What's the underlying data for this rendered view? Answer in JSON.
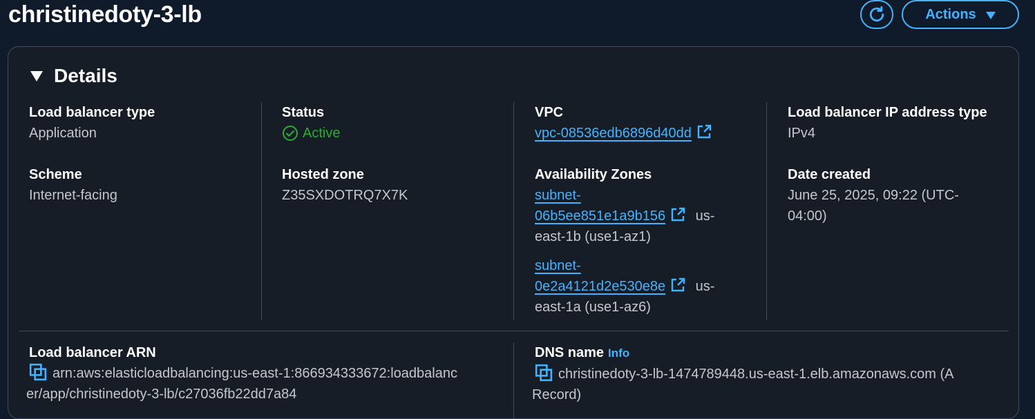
{
  "header": {
    "title": "christinedoty-3-lb",
    "actions_label": "Actions"
  },
  "details": {
    "title": "Details",
    "lb_type": {
      "label": "Load balancer type",
      "value": "Application"
    },
    "scheme": {
      "label": "Scheme",
      "value": "Internet-facing"
    },
    "status": {
      "label": "Status",
      "value": "Active"
    },
    "hosted_zone": {
      "label": "Hosted zone",
      "value": "Z35SXDOTRQ7X7K"
    },
    "vpc": {
      "label": "VPC",
      "value": "vpc-08536edb6896d40dd"
    },
    "availability_zones": {
      "label": "Availability Zones",
      "items": [
        {
          "subnet_line1": "subnet-",
          "subnet_line2": "06b5ee851e1a9b156",
          "zone_suffix": "us-",
          "zone_line2": "east-1b (use1-az1)"
        },
        {
          "subnet_line1": "subnet-",
          "subnet_line2": "0e2a4121d2e530e8e",
          "zone_suffix": "us-",
          "zone_line2": "east-1a (use1-az6)"
        }
      ]
    },
    "ip_type": {
      "label": "Load balancer IP address type",
      "value": "IPv4"
    },
    "date_created": {
      "label": "Date created",
      "line1": "June 25, 2025, 09:22 (UTC-",
      "line2": "04:00)"
    },
    "arn": {
      "label": "Load balancer ARN",
      "line1": "arn:aws:elasticloadbalancing:us-east-1:866934333672:loadbalanc",
      "line2": "er/app/christinedoty-3-lb/c27036fb22dd7a84"
    },
    "dns": {
      "label": "DNS name",
      "info_label": "Info",
      "line1": "christinedoty-3-lb-1474789448.us-east-1.elb.amazonaws.com (A",
      "line2": "Record)"
    }
  },
  "colors": {
    "accent": "#42b4ff",
    "success": "#29ad32",
    "background": "#0f1b2a",
    "panel": "#161d26"
  },
  "icons": [
    "refresh-icon",
    "caret-down-icon",
    "collapse-triangle-icon",
    "check-circle-icon",
    "external-link-icon",
    "copy-icon"
  ]
}
